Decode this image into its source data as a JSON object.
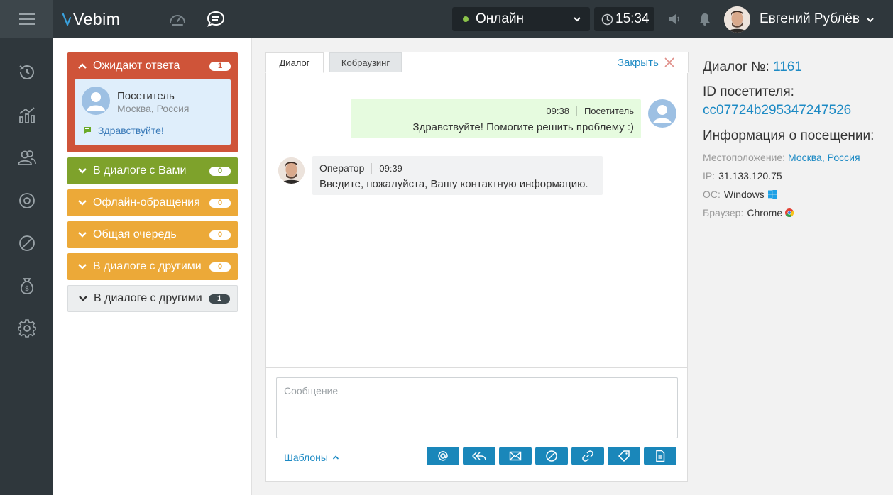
{
  "app": {
    "logo_text": "Vebim"
  },
  "topbar": {
    "status_label": "Онлайн",
    "time": "15:34",
    "user_name": "Евгений Рублёв"
  },
  "queues": [
    {
      "label": "Ожидают ответа",
      "count": "1",
      "color": "#cf5439",
      "expanded": true
    },
    {
      "label": "В диалоге с Вами",
      "count": "0",
      "color": "#7ea22b"
    },
    {
      "label": "Офлайн-обращения",
      "count": "0",
      "color": "#eca938"
    },
    {
      "label": "Общая очередь",
      "count": "0",
      "color": "#eca938"
    },
    {
      "label": "В диалоге с другими",
      "count": "0",
      "color": "#eca938"
    },
    {
      "label": "В диалоге с другими",
      "count": "1",
      "color": "#eceeef"
    }
  ],
  "visitor_card": {
    "name": "Посетитель",
    "location": "Москва, Россия",
    "last_message": "Здравствуйте!"
  },
  "dialog": {
    "tabs": [
      "Диалог",
      "Кобраузинг"
    ],
    "close_label": "Закрыть",
    "messages": [
      {
        "author": "Посетитель",
        "time": "09:38",
        "text": "Здравствуйте! Помогите решить проблему :)"
      },
      {
        "author": "Оператор",
        "time": "09:39",
        "text": "Введите, пожалуйста, Вашу контактную информацию."
      }
    ],
    "input_placeholder": "Сообщение",
    "templates_label": "Шаблоны"
  },
  "info": {
    "dialog_no_label": "Диалог №:",
    "dialog_no": "1161",
    "visitor_id_label": "ID посетителя:",
    "visitor_id": "cc07724b295347247526",
    "visit_info_title": "Информация о посещении:",
    "location_label": "Местоположение:",
    "location": "Москва, Россия",
    "ip_label": "IP:",
    "ip": "31.133.120.75",
    "os_label": "ОС:",
    "os": "Windows",
    "browser_label": "Браузер:",
    "browser": "Chrome"
  },
  "colors": {
    "accent": "#1d8ac4",
    "topbar": "#2f373c",
    "button": "#1a87ba"
  }
}
